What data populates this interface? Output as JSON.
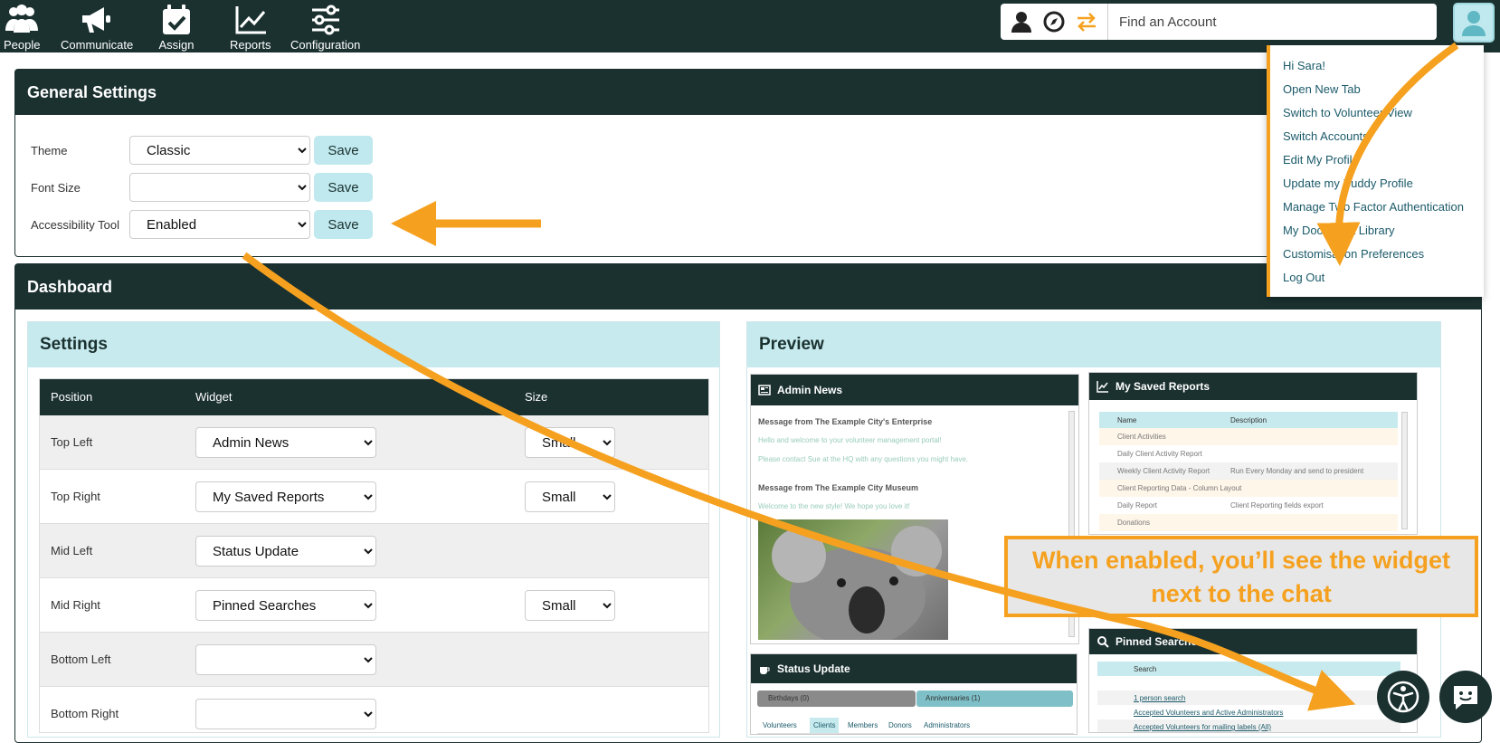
{
  "nav": {
    "items": [
      {
        "label": "People",
        "icon": "people-icon"
      },
      {
        "label": "Communicate",
        "icon": "megaphone-icon"
      },
      {
        "label": "Assign",
        "icon": "calendar-check-icon"
      },
      {
        "label": "Reports",
        "icon": "line-chart-icon"
      },
      {
        "label": "Configuration",
        "icon": "sliders-icon"
      }
    ],
    "search_placeholder": "Find an Account"
  },
  "general_settings": {
    "title": "General Settings",
    "rows": [
      {
        "label": "Theme",
        "value": "Classic",
        "save": "Save"
      },
      {
        "label": "Font Size",
        "value": "",
        "save": "Save"
      },
      {
        "label": "Accessibility Tool",
        "value": "Enabled",
        "save": "Save"
      }
    ]
  },
  "dashboard": {
    "title": "Dashboard",
    "settings_title": "Settings",
    "preview_title": "Preview",
    "columns": {
      "position": "Position",
      "widget": "Widget",
      "size": "Size"
    },
    "rows": [
      {
        "position": "Top Left",
        "widget": "Admin News",
        "size": "Small"
      },
      {
        "position": "Top Right",
        "widget": "My Saved Reports",
        "size": "Small"
      },
      {
        "position": "Mid Left",
        "widget": "Status Update",
        "size": ""
      },
      {
        "position": "Mid Right",
        "widget": "Pinned Searches",
        "size": "Small"
      },
      {
        "position": "Bottom Left",
        "widget": "",
        "size": ""
      },
      {
        "position": "Bottom Right",
        "widget": "",
        "size": ""
      }
    ]
  },
  "preview": {
    "admin_news": {
      "title": "Admin News",
      "msg1_title": "Message from The Example City's Enterprise",
      "msg1_line1": "Hello and welcome to your volunteer management portal!",
      "msg1_line2": "Please contact Sue at the HQ with any questions you might have.",
      "msg2_title": "Message from The Example City Museum",
      "msg2_line1": "Welcome to the new style! We hope you love it!"
    },
    "saved_reports": {
      "title": "My Saved Reports",
      "col_name": "Name",
      "col_desc": "Description",
      "rows": [
        {
          "name": "Client Activities",
          "desc": ""
        },
        {
          "name": "Daily Client Activity Report",
          "desc": ""
        },
        {
          "name": "Weekly Client Activity Report",
          "desc": "Run Every Monday and send to president"
        },
        {
          "name": "Client Reporting Data - Column Layout",
          "desc": ""
        },
        {
          "name": "Daily Report",
          "desc": "Client Reporting fields export"
        },
        {
          "name": "Donations",
          "desc": ""
        }
      ]
    },
    "status_update": {
      "title": "Status Update",
      "birthdays": "Birthdays (0)",
      "anniversaries": "Anniversaries (1)",
      "tabs": [
        "Volunteers",
        "Clients",
        "Members",
        "Donors",
        "Administrators"
      ]
    },
    "pinned_searches": {
      "title": "Pinned Searches",
      "col_search": "Search",
      "rows": [
        "1 person search",
        "Accepted Volunteers and Active Administrators",
        "Accepted Volunteers for mailing labels (All)"
      ]
    }
  },
  "user_menu": {
    "items": [
      "Hi Sara!",
      "Open New Tab",
      "Switch to Volunteer View",
      "Switch Accounts",
      "Edit My Profile",
      "Update my Buddy Profile",
      "Manage Two Factor Authentication",
      "My Document Library",
      "Customisation Preferences",
      "Log Out"
    ]
  },
  "callout": {
    "line1": "When enabled, you’ll see the widget",
    "line2": "next to the chat"
  },
  "colors": {
    "dark": "#1b3130",
    "accent": "#f5a11f",
    "light": "#c7eaee"
  }
}
